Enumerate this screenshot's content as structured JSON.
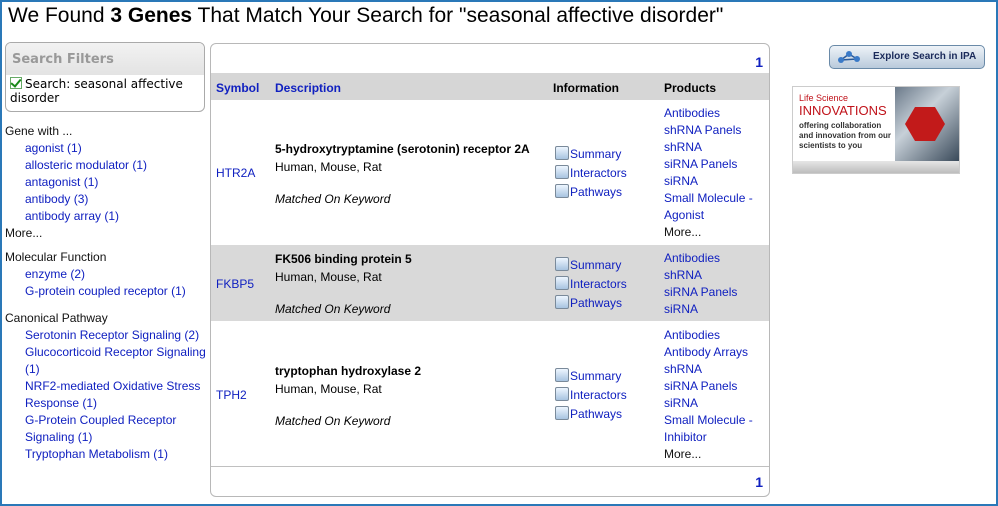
{
  "heading": {
    "pre": "We Found ",
    "count": "3",
    "genes": "Genes",
    "post": " That Match Your Search for \"seasonal affective disorder\""
  },
  "filters": {
    "title": "Search Filters",
    "item": "Search: seasonal affective disorder"
  },
  "facets": {
    "gene_with": {
      "title": "Gene with ...",
      "items": [
        "agonist (1)",
        "allosteric modulator (1)",
        "antagonist (1)",
        "antibody (3)",
        "antibody array (1)"
      ],
      "more": "More..."
    },
    "molecular_function": {
      "title": "Molecular Function",
      "items": [
        "enzyme (2)",
        "G-protein coupled receptor (1)"
      ]
    },
    "canonical_pathway": {
      "title": "Canonical Pathway",
      "items": [
        "Serotonin Receptor Signaling (2)",
        "Glucocorticoid Receptor Signaling (1)",
        "NRF2-mediated Oxidative Stress Response (1)",
        "G-Protein Coupled Receptor Signaling (1)",
        "Tryptophan Metabolism (1)"
      ]
    }
  },
  "table": {
    "page": "1",
    "headers": {
      "symbol": "Symbol",
      "description": "Description",
      "information": "Information",
      "products": "Products"
    },
    "info_links": [
      "Summary",
      "Interactors",
      "Pathways"
    ],
    "rows": [
      {
        "symbol": "HTR2A",
        "name": "5-hydroxytryptamine (serotonin) receptor 2A",
        "species": "Human, Mouse, Rat",
        "match": "Matched On Keyword",
        "products": [
          "Antibodies",
          "shRNA Panels",
          "shRNA",
          "siRNA Panels",
          "siRNA",
          "Small Molecule - Agonist"
        ],
        "more": "More..."
      },
      {
        "symbol": "FKBP5",
        "name": "FK506 binding protein 5",
        "species": "Human, Mouse, Rat",
        "match": "Matched On Keyword",
        "products": [
          "Antibodies",
          "shRNA",
          "siRNA Panels",
          "siRNA"
        ],
        "more": ""
      },
      {
        "symbol": "TPH2",
        "name": "tryptophan hydroxylase 2",
        "species": "Human, Mouse, Rat",
        "match": "Matched On Keyword",
        "products": [
          "Antibodies",
          "Antibody Arrays",
          "shRNA",
          "siRNA Panels",
          "siRNA",
          "Small Molecule - Inhibitor"
        ],
        "more": "More..."
      }
    ]
  },
  "ipa_button": "Explore Search in IPA",
  "ad": {
    "line1": "Life Science",
    "line2": "INNOVATIONS",
    "line3": "offering collaboration and innovation from our scientists to you"
  }
}
